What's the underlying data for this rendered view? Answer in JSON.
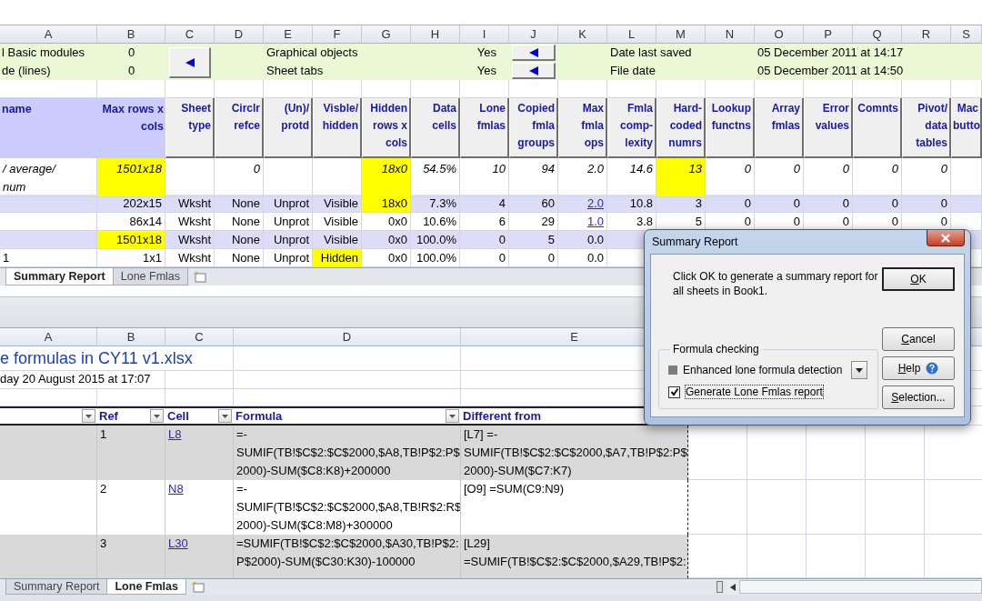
{
  "upper_sheet": {
    "columns": [
      "A",
      "B",
      "C",
      "D",
      "E",
      "F",
      "G",
      "H",
      "I",
      "J",
      "K",
      "L",
      "M",
      "N",
      "O",
      "P",
      "Q",
      "R",
      "S"
    ],
    "info_rows": [
      {
        "label": "l Basic modules",
        "value": "0",
        "item": "Graphical objects",
        "answer": "Yes",
        "date_label": "Date last saved",
        "date": "05 December 2011 at 14:17"
      },
      {
        "label": "de (lines)",
        "value": "0",
        "item": "Sheet tabs",
        "answer": "Yes",
        "date_label": "File date",
        "date": "05 December 2011 at 14:50"
      }
    ],
    "headers": [
      "name",
      "Max rows x cols",
      "Sheet type",
      "Circlr refce",
      "(Un)/ protd",
      "Visble/ hidden",
      "Hidden rows x cols",
      "Data cells",
      "Lone fmlas",
      "Copied fmla groups",
      "Max fmla ops",
      "Fmla comp-lexity",
      "Hard-coded numrs",
      "Lookup functns",
      "Array fmlas",
      "Error values",
      "Comnts",
      "Pivot/ data tables",
      "Mac butto"
    ],
    "summary_row": {
      "A": "/ average/\nnum",
      "B": {
        "text": "1501x18",
        "highlighted": true
      },
      "D": "0",
      "G": {
        "text": "18x0",
        "highlighted": true
      },
      "H": "54.5%",
      "I": "10",
      "J": "94",
      "K": "2.0",
      "L": "14.6",
      "M": {
        "text": "13",
        "highlighted": true
      },
      "N": "0",
      "O": "0",
      "P": "0",
      "Q": "0",
      "R": "0"
    },
    "rows": [
      {
        "cells": {
          "B": "202x15",
          "C": "Wksht",
          "D": "None",
          "E": "Unprot",
          "F": "Visible",
          "G": {
            "text": "18x0",
            "highlighted": true
          },
          "H": "7.3%",
          "I": "4",
          "J": "60",
          "K": {
            "text": "2.0",
            "link": true
          },
          "L": "10.8",
          "M": "3",
          "N": "0",
          "O": "0",
          "P": "0",
          "Q": "0",
          "R": "0"
        }
      },
      {
        "cells": {
          "B": "86x14",
          "C": "Wksht",
          "D": "None",
          "E": "Unprot",
          "F": "Visible",
          "G": "0x0",
          "H": "10.6%",
          "I": "6",
          "J": "29",
          "K": {
            "text": "1.0",
            "link": true
          },
          "L": "3.8",
          "M": "5",
          "N": "0",
          "O": "0",
          "P": "0",
          "Q": "0",
          "R": "0"
        }
      },
      {
        "cells": {
          "B": {
            "text": "1501x18",
            "highlighted": true
          },
          "C": "Wksht",
          "D": "None",
          "E": "Unprot",
          "F": "Visible",
          "G": "0x0",
          "H": "100.0%",
          "I": "0",
          "J": "5",
          "K": "0.0"
        }
      },
      {
        "cells": {
          "A": "1",
          "B": "1x1",
          "C": "Wksht",
          "D": "None",
          "E": "Unprot",
          "F": {
            "text": "Hidden",
            "highlighted": true
          },
          "G": "0x0",
          "H": "100.0%",
          "I": "0",
          "J": "0",
          "K": "0.0"
        }
      }
    ],
    "tabs": [
      {
        "label": "Summary Report",
        "selected": true
      },
      {
        "label": "Lone Fmlas",
        "selected": false
      }
    ]
  },
  "lower_sheet": {
    "columns": [
      "A",
      "B",
      "C",
      "D",
      "E"
    ],
    "title": "e formulas in CY11 v1.xlsx",
    "subtitle": "day 20 August 2015 at 17:07",
    "headers": [
      "Ref",
      "Cell",
      "Formula",
      "Different from"
    ],
    "rows": [
      {
        "ref": "1",
        "cell": "L8",
        "formula": "=-\nSUMIF(TB!$C$2:$C$2000,$A8,TB!P$2:P$\n2000)-SUM($C8:K8)+200000",
        "different_from": "[L7] =-\nSUMIF(TB!$C$2:$C$2000,$A7,TB!P$2:P$\n2000)-SUM($C7:K7)"
      },
      {
        "ref": "2",
        "cell": "N8",
        "formula": "=-\nSUMIF(TB!$C$2:$C$2000,$A8,TB!R$2:R$\n2000)-SUM($C8:M8)+300000",
        "different_from": "[O9] =SUM(C9:N9)"
      },
      {
        "ref": "3",
        "cell": "L30",
        "formula": "=SUMIF(TB!$C$2:$C$2000,$A30,TB!P$2:\nP$2000)-SUM($C30:K30)-100000",
        "different_from": "[L29]\n=SUMIF(TB!$C$2:$C$2000,$A29,TB!P$2:"
      }
    ],
    "tabs": [
      {
        "label": "Summary Report",
        "selected": false
      },
      {
        "label": "Lone Fmlas",
        "selected": true
      }
    ]
  },
  "dialog": {
    "title": "Summary Report",
    "message": "Click OK to generate a summary report for all sheets in Book1.",
    "buttons": [
      "OK",
      "Cancel",
      "Help",
      "Selection..."
    ],
    "group": {
      "title": "Formula checking",
      "options": [
        {
          "kind": "dropdown",
          "label": "Enhanced lone formula detection"
        },
        {
          "kind": "checkbox",
          "label": "Generate Lone Fmlas report",
          "checked": true
        }
      ]
    }
  }
}
